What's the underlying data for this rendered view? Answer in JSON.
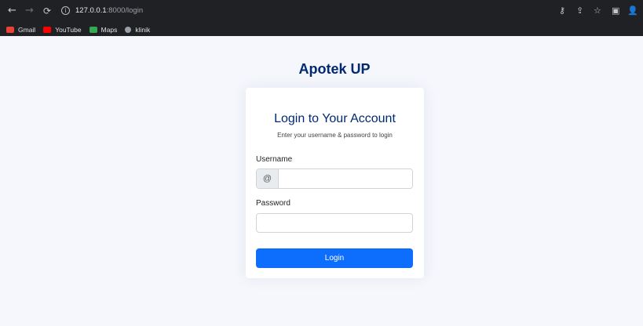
{
  "browser": {
    "url_host": "127.0.0.1",
    "url_rest": ":8000/login",
    "bookmarks": [
      {
        "label": "Gmail",
        "color": "#ea4335"
      },
      {
        "label": "YouTube",
        "color": "#ff0000"
      },
      {
        "label": "Maps",
        "color": "#34a853"
      },
      {
        "label": "klinik",
        "color": "#9aa0a6"
      }
    ]
  },
  "page": {
    "brand": "Apotek UP",
    "card_title": "Login to Your Account",
    "card_subtitle": "Enter your username & password to login",
    "username_label": "Username",
    "username_prefix": "@",
    "username_value": "",
    "password_label": "Password",
    "password_value": "",
    "login_label": "Login"
  },
  "colors": {
    "brand": "#012970",
    "primary_button": "#0d6efd",
    "page_background": "#f5f7fc",
    "chrome_background": "#202124"
  }
}
